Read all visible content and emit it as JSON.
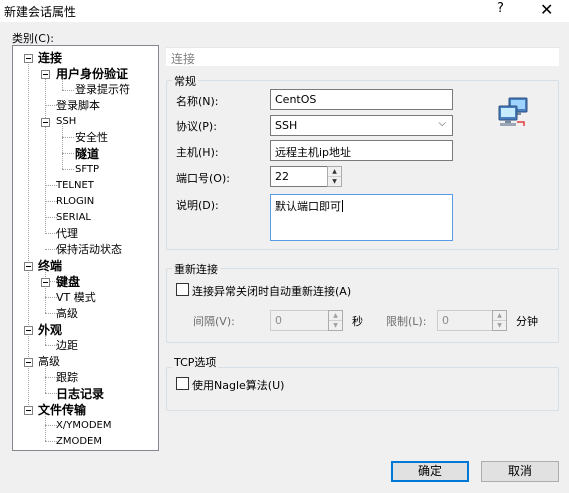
{
  "window": {
    "title": "新建会话属性",
    "help_label": "?",
    "close_label": "✕"
  },
  "category": {
    "label": "类别(C):",
    "tree": [
      {
        "id": "connection",
        "label": "连接",
        "bold": true
      },
      {
        "id": "user-auth",
        "label": "用户身份验证",
        "bold": true
      },
      {
        "id": "login-prompt",
        "label": "登录提示符",
        "bold": false
      },
      {
        "id": "login-script",
        "label": "登录脚本",
        "bold": false
      },
      {
        "id": "ssh",
        "label": "SSH",
        "bold": false
      },
      {
        "id": "security",
        "label": "安全性",
        "bold": false
      },
      {
        "id": "tunnel",
        "label": "隧道",
        "bold": true
      },
      {
        "id": "sftp",
        "label": "SFTP",
        "bold": false
      },
      {
        "id": "telnet",
        "label": "TELNET",
        "bold": false
      },
      {
        "id": "rlogin",
        "label": "RLOGIN",
        "bold": false
      },
      {
        "id": "serial",
        "label": "SERIAL",
        "bold": false
      },
      {
        "id": "proxy",
        "label": "代理",
        "bold": false
      },
      {
        "id": "keepalive",
        "label": "保持活动状态",
        "bold": false
      },
      {
        "id": "terminal",
        "label": "终端",
        "bold": true
      },
      {
        "id": "keyboard",
        "label": "键盘",
        "bold": true
      },
      {
        "id": "vt-mode",
        "label": "VT 模式",
        "bold": false
      },
      {
        "id": "advanced-terminal",
        "label": "高级",
        "bold": false
      },
      {
        "id": "appearance",
        "label": "外观",
        "bold": true
      },
      {
        "id": "margin",
        "label": "边距",
        "bold": false
      },
      {
        "id": "advanced",
        "label": "高级",
        "bold": false
      },
      {
        "id": "trace",
        "label": "跟踪",
        "bold": false
      },
      {
        "id": "logging",
        "label": "日志记录",
        "bold": true
      },
      {
        "id": "file-transfer",
        "label": "文件传输",
        "bold": true
      },
      {
        "id": "xymodem",
        "label": "X/YMODEM",
        "bold": false
      },
      {
        "id": "zmodem",
        "label": "ZMODEM",
        "bold": false
      }
    ]
  },
  "section_title": "连接",
  "general": {
    "title": "常规",
    "name_label": "名称(N):",
    "name_value": "CentOS",
    "protocol_label": "协议(P):",
    "protocol_value": "SSH",
    "host_label": "主机(H):",
    "host_value": "远程主机ip地址",
    "port_label": "端口号(O):",
    "port_value": "22",
    "desc_label": "说明(D):",
    "desc_value": "默认端口即可"
  },
  "reconnect": {
    "title": "重新连接",
    "checkbox_label": "连接异常关闭时自动重新连接(A)",
    "interval_label": "间隔(V):",
    "interval_value": "0",
    "seconds_label": "秒",
    "limit_label": "限制(L):",
    "limit_value": "0",
    "minutes_label": "分钟"
  },
  "tcp": {
    "title": "TCP选项",
    "nagle_label": "使用Nagle算法(U)"
  },
  "buttons": {
    "ok": "确定",
    "cancel": "取消"
  },
  "icons": {
    "session": "network-computers-icon"
  }
}
